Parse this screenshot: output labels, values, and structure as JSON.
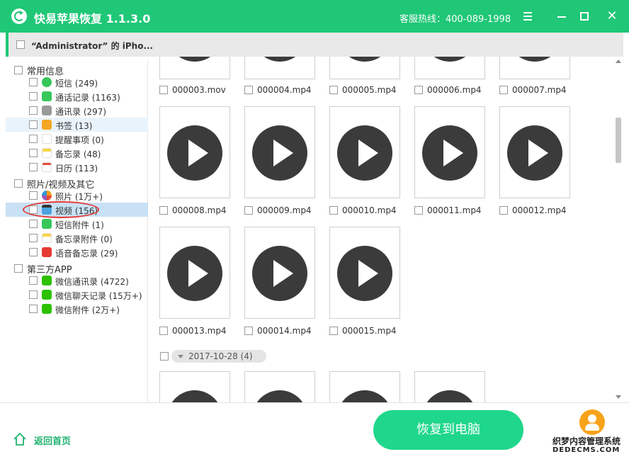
{
  "app": {
    "title": "快易苹果恢复 1.1.3.0",
    "hotline": "客服热线：400-089-1998",
    "close_glyph": "✕"
  },
  "device": {
    "name": "“Administrator” 的 iPho..."
  },
  "sidebar": {
    "groups": [
      {
        "label": "常用信息",
        "items": [
          {
            "label": "短信",
            "count": "(249)",
            "icon": "message-icon",
            "color": "#35c759"
          },
          {
            "label": "通话记录",
            "count": "(1163)",
            "icon": "phone-icon",
            "color": "#35c759"
          },
          {
            "label": "通讯录",
            "count": "(297)",
            "icon": "contacts-icon",
            "color": "#9a9a9a"
          },
          {
            "label": "书签",
            "count": "(13)",
            "icon": "bookmark-icon",
            "color": "#f5a623"
          },
          {
            "label": "提醒事项",
            "count": "(0)",
            "icon": "reminders-icon",
            "color": "#d9d9d9"
          },
          {
            "label": "备忘录",
            "count": "(48)",
            "icon": "notes-icon",
            "color": "#f8d548"
          },
          {
            "label": "日历",
            "count": "(113)",
            "icon": "calendar-icon",
            "color": "#e74c3c"
          }
        ]
      },
      {
        "label": "照片/视频及其它",
        "items": [
          {
            "label": "照片",
            "count": "(1万+)",
            "icon": "photos-icon",
            "color": "#f39c12"
          },
          {
            "label": "视频",
            "count": "(156)",
            "icon": "video-icon",
            "color": "#4aa3df"
          },
          {
            "label": "短信附件",
            "count": "(1)",
            "icon": "attachment-icon",
            "color": "#35c759"
          },
          {
            "label": "备忘录附件",
            "count": "(0)",
            "icon": "notes-attachment-icon",
            "color": "#f8d548"
          },
          {
            "label": "语音备忘录",
            "count": "(29)",
            "icon": "voice-memo-icon",
            "color": "#e53935"
          }
        ]
      },
      {
        "label": "第三方APP",
        "items": [
          {
            "label": "微信通讯录",
            "count": "(4722)",
            "icon": "wechat-contacts-icon",
            "color": "#2dc100"
          },
          {
            "label": "微信聊天记录",
            "count": "(15万+)",
            "icon": "wechat-chat-icon",
            "color": "#2dc100"
          },
          {
            "label": "微信附件",
            "count": "(2万+)",
            "icon": "wechat-attachment-icon",
            "color": "#2dc100"
          }
        ]
      }
    ]
  },
  "videos": {
    "row1": [
      "000003.mov",
      "000004.mp4",
      "000005.mp4",
      "000006.mp4",
      "000007.mp4"
    ],
    "row2": [
      "000008.mp4",
      "000009.mp4",
      "000010.mp4",
      "000011.mp4",
      "000012.mp4"
    ],
    "row3": [
      "000013.mp4",
      "000014.mp4",
      "000015.mp4"
    ],
    "date_group": "2017-10-28 (4)"
  },
  "footer": {
    "home_label": "返回首页",
    "recover_label": "恢复到电脑",
    "watermark_line1": "织梦内容管理系统",
    "watermark_line2": "DEDECMS.COM"
  }
}
